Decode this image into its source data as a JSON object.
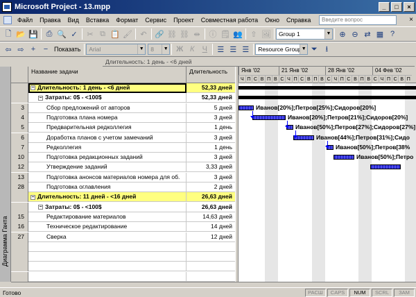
{
  "window": {
    "title": "Microsoft Project - 13.mpp",
    "buttons": [
      "_",
      "□",
      "×"
    ]
  },
  "menu": {
    "items": [
      "Файл",
      "Правка",
      "Вид",
      "Вставка",
      "Формат",
      "Сервис",
      "Проект",
      "Совместная работа",
      "Окно",
      "Справка"
    ],
    "help_placeholder": "Введите вопрос",
    "close": "×"
  },
  "toolbar1": {
    "group_combo": "Group 1"
  },
  "toolbar2": {
    "show_label": "Показать",
    "font_combo": "Arial",
    "size_combo": "8",
    "bold": "Ж",
    "italic": "К",
    "underline": "Ч",
    "resource_group_combo": "Resource Group...",
    "filter_icon": "filter-icon"
  },
  "entry_bar": {
    "value": "Длительность: 1 день - <6 дней"
  },
  "side_view_label": "Диаграмма Ганта",
  "grid": {
    "headers": {
      "name": "Название задачи",
      "duration": "Длительность"
    },
    "rows": [
      {
        "id": "",
        "name": "Длительность: 1 день - <6 дней",
        "duration": "52,33 дней",
        "level": 1,
        "box": "−"
      },
      {
        "id": "",
        "name": "Затраты: 0$ - <100$",
        "duration": "52,33 дней",
        "level": 2,
        "box": "−"
      },
      {
        "id": "3",
        "name": "Сбор предложений от авторов",
        "duration": "5 дней",
        "level": 3
      },
      {
        "id": "4",
        "name": "Подготовка плана номера",
        "duration": "3 дней",
        "level": 3
      },
      {
        "id": "5",
        "name": "Предварительная редколлегия",
        "duration": "1 день",
        "level": 3
      },
      {
        "id": "6",
        "name": "Доработка планов с учетом замечаний",
        "duration": "3 дней",
        "level": 3
      },
      {
        "id": "7",
        "name": "Редколлегия",
        "duration": "1 день",
        "level": 3
      },
      {
        "id": "10",
        "name": "Подготовка редакционных заданий",
        "duration": "3 дней",
        "level": 3
      },
      {
        "id": "12",
        "name": "Утверждение заданий",
        "duration": "3,33 дней",
        "level": 3
      },
      {
        "id": "13",
        "name": "Подготовка анонсов материалов номера для об.",
        "duration": "3 дней",
        "level": 3
      },
      {
        "id": "28",
        "name": "Подготовка оглавления",
        "duration": "2 дней",
        "level": 3
      },
      {
        "id": "",
        "name": "Длительность: 11 дней - <16 дней",
        "duration": "26,63 дней",
        "level": 1,
        "box": "−"
      },
      {
        "id": "",
        "name": "Затраты: 0$ - <100$",
        "duration": "26,63 дней",
        "level": 2,
        "box": "−"
      },
      {
        "id": "15",
        "name": "Редактирование материалов",
        "duration": "14,63 дней",
        "level": 3
      },
      {
        "id": "16",
        "name": "Техническое редактирование",
        "duration": "14 дней",
        "level": 3
      },
      {
        "id": "27",
        "name": "Сверка",
        "duration": "12 дней",
        "level": 3
      },
      {
        "id": "",
        "name": "",
        "duration": "",
        "level": 0
      },
      {
        "id": "",
        "name": "",
        "duration": "",
        "level": 0
      },
      {
        "id": "",
        "name": "",
        "duration": "",
        "level": 0
      },
      {
        "id": "",
        "name": "",
        "duration": "",
        "level": 0
      }
    ]
  },
  "gantt": {
    "weeks": [
      "Янв '02",
      "21 Янв '02",
      "28 Янв '02",
      "04 Фев '02"
    ],
    "days": [
      "Ч",
      "П",
      "С",
      "В",
      "П",
      "В",
      "С",
      "Ч",
      "П",
      "С",
      "В",
      "П",
      "В",
      "С",
      "Ч",
      "П",
      "С",
      "В",
      "П",
      "В",
      "С",
      "Ч",
      "П",
      "С",
      "В",
      "П"
    ],
    "resource_labels": [
      "Иванов[20%];Петров[25%];Сидоров[20%]",
      "Иванов[20%];Петров[21%];Сидоров[20%]",
      "Иванов[50%];Петров[27%];Сидоров[27%]",
      "Иванов[44%];Петров[31%];Сидо",
      "Иванов[50%];Петров[38%",
      "Иванов[50%];Петро"
    ]
  },
  "status": {
    "text": "Готово",
    "indicators": [
      "РАСШ",
      "CAPS",
      "NUM",
      "SCRL",
      "ЗАМ"
    ],
    "active": [
      "NUM"
    ]
  }
}
